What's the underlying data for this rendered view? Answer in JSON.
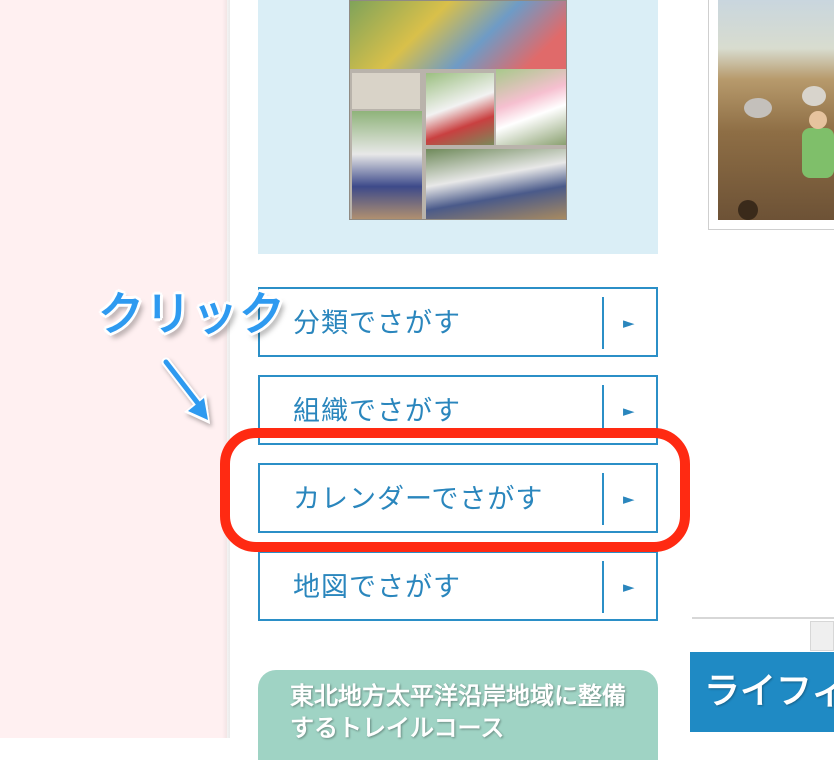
{
  "annotation": {
    "click_label": "クリック",
    "accent_color": "#ff2a12",
    "label_color": "#2e9af0"
  },
  "search_menu": {
    "items": [
      {
        "label": "分類でさがす",
        "arrow": "►"
      },
      {
        "label": "組織でさがす",
        "arrow": "►"
      },
      {
        "label": "カレンダーでさがす",
        "arrow": "►"
      },
      {
        "label": "地図でさがす",
        "arrow": "►"
      }
    ]
  },
  "banners": {
    "trail": "東北地方太平洋沿岸地域に整備するトレイルコース",
    "life": "ライフィ"
  },
  "colors": {
    "button_border": "#2b8fc7",
    "button_text": "#2a86bd",
    "magazine_panel": "#daeef6",
    "trail_banner": "#9fd3c4",
    "life_banner": "#1f8ac4"
  }
}
